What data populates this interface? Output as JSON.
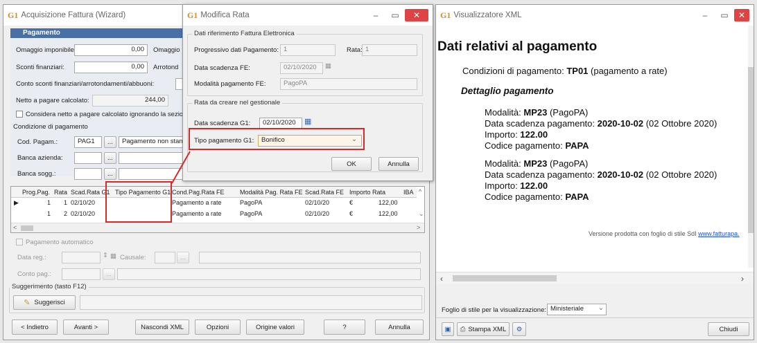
{
  "wizard": {
    "title": "Acquisizione Fattura (Wizard)",
    "section_title": "Pagamento",
    "omaggio_imponibile_label": "Omaggio imponibile:",
    "omaggio_imponibile_value": "0,00",
    "omaggio_label": "Omaggio",
    "sconti_label": "Sconti finanziari:",
    "sconti_value": "0,00",
    "arrotond_label": "Arrotond",
    "conto_sconti_label": "Conto sconti finanziari/arrotondamenti/abbuoni:",
    "netto_label": "Netto a pagare calcolato:",
    "netto_value": "244,00",
    "considera_label": "Considera netto a pagare calcolato ignorando la sezion",
    "condizione_label": "Condizione di pagamento",
    "cod_pagam_label": "Cod. Pagam.:",
    "cod_pagam_value": "PAG1",
    "cod_pagam_desc": "Pagamento non stand",
    "banca_azienda_label": "Banca azienda:",
    "banca_sogg_label": "Banca sogg.:",
    "ellipsis": "...",
    "grid_headers": [
      "Prog.Pag.",
      "Rata",
      "Scad.Rata G1",
      "Tipo Pagamento G1",
      "Cond.Pag.Rata FE",
      "Modalità Pag. Rata FE",
      "Scad.Rata FE",
      "Importo Rata",
      "IBA"
    ],
    "grid_rows": [
      {
        "prog": "1",
        "rata": "1",
        "scad": "02/10/20",
        "tipo": "",
        "cond": "Pagamento a rate",
        "mod": "PagoPA",
        "scadfe": "02/10/20",
        "cur": "€",
        "importo": "122,00"
      },
      {
        "prog": "1",
        "rata": "2",
        "scad": "02/10/20",
        "tipo": "",
        "cond": "Pagamento a rate",
        "mod": "PagoPA",
        "scadfe": "02/10/20",
        "cur": "€",
        "importo": "122,00"
      }
    ],
    "pagamento_automatico_label": "Pagamento automatico",
    "data_reg_label": "Data reg.:",
    "causale_label": "Causale:",
    "conto_pag_label": "Conto pag.:",
    "suggerimento_label": "Suggerimento (tasto F12)",
    "suggerisci_label": "Suggerisci",
    "buttons": {
      "indietro": "< Indietro",
      "avanti": "Avanti >",
      "nascondi_xml": "Nascondi XML",
      "opzioni": "Opzioni",
      "origine": "Origine valori",
      "help": "?",
      "annulla": "Annulla"
    }
  },
  "modal": {
    "title": "Modifica Rata",
    "group1_title": "Dati riferimento Fattura Elettronica",
    "progressivo_label": "Progressivo dati Pagamento:",
    "progressivo_value": "1",
    "rata_label": "Rata:",
    "rata_value": "1",
    "data_scadenza_fe_label": "Data scadenza FE:",
    "data_scadenza_fe_value": "02/10/2020",
    "modalita_label": "Modalità pagamento FE:",
    "modalita_value": "PagoPA",
    "group2_title": "Rata da creare nel gestionale",
    "data_scadenza_g1_label": "Data scadenza G1:",
    "data_scadenza_g1_value": "02/10/2020",
    "tipo_pagamento_label": "Tipo pagamento G1:",
    "tipo_pagamento_value": "Bonifico",
    "ok_label": "OK",
    "annulla_label": "Annulla"
  },
  "xml_viewer": {
    "title": "Visualizzatore XML",
    "heading": "Dati relativi al pagamento",
    "condizioni_prefix": "Condizioni di pagamento: ",
    "condizioni_code": "TP01",
    "condizioni_desc": " (pagamento a rate)",
    "dettaglio_title": "Dettaglio pagamento",
    "details": [
      {
        "modalita_prefix": "Modalità: ",
        "modalita_code": "MP23",
        "modalita_desc": " (PagoPA)",
        "scadenza_prefix": "Data scadenza pagamento: ",
        "scadenza_date": "2020-10-02",
        "scadenza_desc": " (02 Ottobre 2020)",
        "importo_prefix": "Importo: ",
        "importo_value": "122.00",
        "codice_prefix": "Codice pagamento: ",
        "codice_value": "PAPA"
      },
      {
        "modalita_prefix": "Modalità: ",
        "modalita_code": "MP23",
        "modalita_desc": " (PagoPA)",
        "scadenza_prefix": "Data scadenza pagamento: ",
        "scadenza_date": "2020-10-02",
        "scadenza_desc": " (02 Ottobre 2020)",
        "importo_prefix": "Importo: ",
        "importo_value": "122.00",
        "codice_prefix": "Codice pagamento: ",
        "codice_value": "PAPA"
      }
    ],
    "footer_text": "Versione prodotta con foglio di stile SdI ",
    "footer_link": "www.fatturapa.",
    "foglio_label": "Foglio di stile per la visualizzazione:",
    "foglio_value": "Ministeriale",
    "stampa_label": "Stampa XML",
    "chiudi_label": "Chiudi"
  },
  "colors": {
    "accent_red": "#d22b2b",
    "section_blue": "#4a6fa5",
    "logo_orange": "#d98c1f"
  }
}
